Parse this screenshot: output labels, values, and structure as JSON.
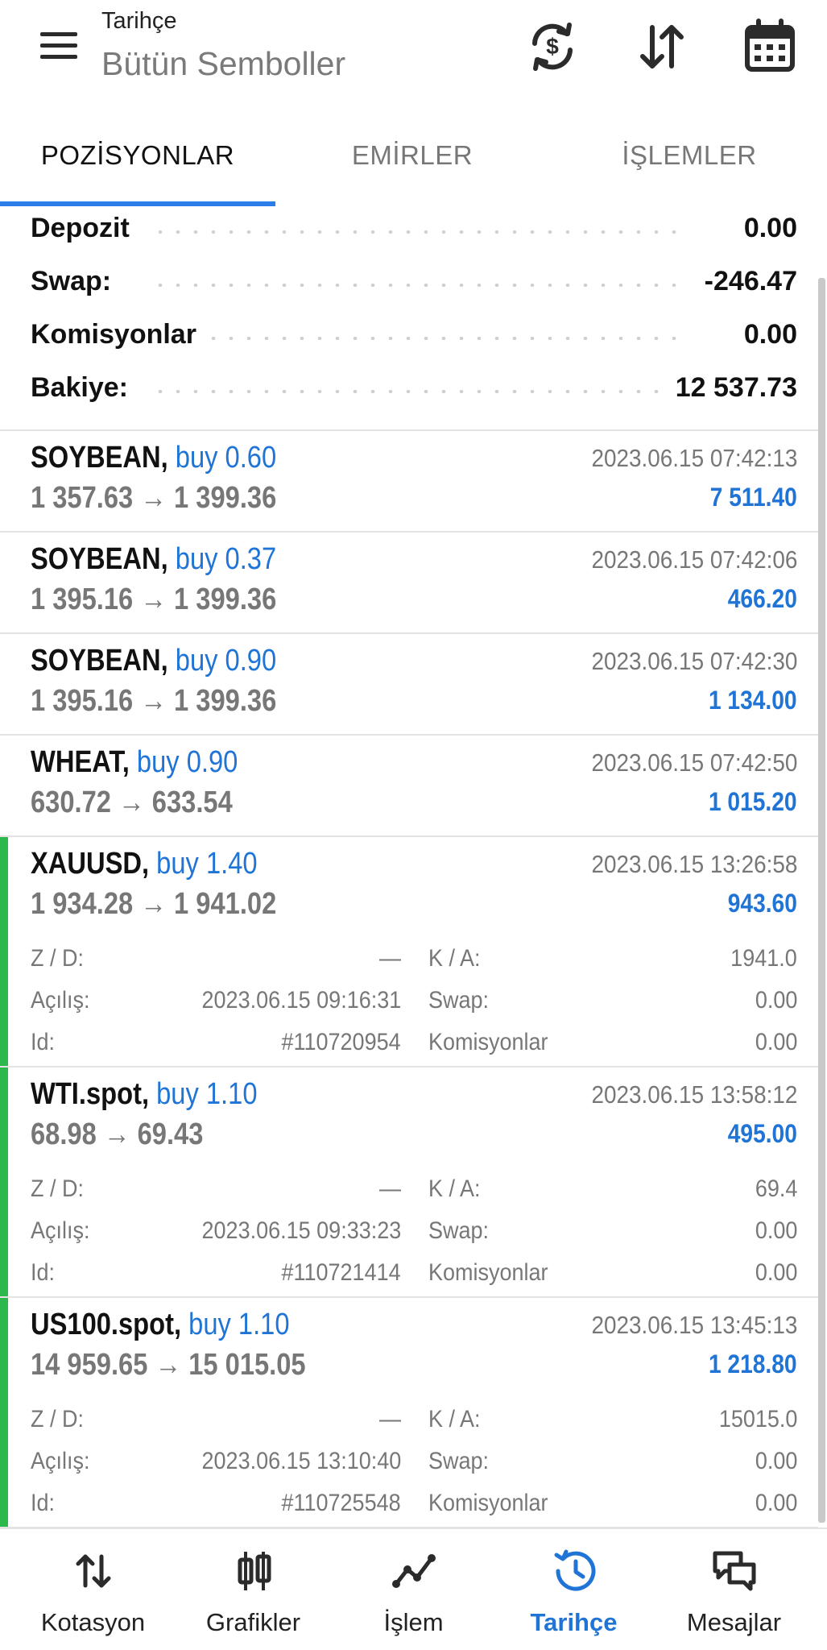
{
  "header": {
    "title": "Tarihçe",
    "subtitle": "Bütün Semboller",
    "icons": [
      "menu-icon",
      "currency-sync-icon",
      "sort-icon",
      "calendar-icon"
    ]
  },
  "tabs": [
    {
      "label": "POZİSYONLAR",
      "active": true
    },
    {
      "label": "EMİRLER",
      "active": false
    },
    {
      "label": "İŞLEMLER",
      "active": false
    }
  ],
  "summary": [
    {
      "label": "Depozit",
      "value": "0.00"
    },
    {
      "label": "Swap:",
      "value": "-246.47"
    },
    {
      "label": "Komisyonlar",
      "value": "0.00"
    },
    {
      "label": "Bakiye:",
      "value": "12 537.73"
    }
  ],
  "trades": [
    {
      "symbol": "SOYBEAN,",
      "side": "buy 0.60",
      "prices": "1 357.63 → 1 399.36",
      "time": "2023.06.15 07:42:13",
      "profit": "7 511.40"
    },
    {
      "symbol": "SOYBEAN,",
      "side": "buy 0.37",
      "prices": "1 395.16 → 1 399.36",
      "time": "2023.06.15 07:42:06",
      "profit": "466.20"
    },
    {
      "symbol": "SOYBEAN,",
      "side": "buy 0.90",
      "prices": "1 395.16 → 1 399.36",
      "time": "2023.06.15 07:42:30",
      "profit": "1 134.00"
    },
    {
      "symbol": "WHEAT,",
      "side": "buy 0.90",
      "prices": "630.72 → 633.54",
      "time": "2023.06.15 07:42:50",
      "profit": "1 015.20"
    },
    {
      "symbol": "XAUUSD,",
      "side": "buy 1.40",
      "prices": "1 934.28 → 1 941.02",
      "time": "2023.06.15 13:26:58",
      "profit": "943.60",
      "details": {
        "zd_label": "Z / D:",
        "zd": "—",
        "ka_label": "K / A:",
        "ka": "1941.0",
        "open_label": "Açılış:",
        "open": "2023.06.15 09:16:31",
        "swap_label": "Swap:",
        "swap": "0.00",
        "id_label": "Id:",
        "id": "#110720954",
        "comm_label": "Komisyonlar",
        "comm": "0.00"
      }
    },
    {
      "symbol": "WTI.spot,",
      "side": "buy 1.10",
      "prices": "68.98 → 69.43",
      "time": "2023.06.15 13:58:12",
      "profit": "495.00",
      "details": {
        "zd_label": "Z / D:",
        "zd": "—",
        "ka_label": "K / A:",
        "ka": "69.4",
        "open_label": "Açılış:",
        "open": "2023.06.15 09:33:23",
        "swap_label": "Swap:",
        "swap": "0.00",
        "id_label": "Id:",
        "id": "#110721414",
        "comm_label": "Komisyonlar",
        "comm": "0.00"
      }
    },
    {
      "symbol": "US100.spot,",
      "side": "buy 1.10",
      "prices": "14 959.65 → 15 015.05",
      "time": "2023.06.15 13:45:13",
      "profit": "1 218.80",
      "details": {
        "zd_label": "Z / D:",
        "zd": "—",
        "ka_label": "K / A:",
        "ka": "15015.0",
        "open_label": "Açılış:",
        "open": "2023.06.15 13:10:40",
        "swap_label": "Swap:",
        "swap": "0.00",
        "id_label": "Id:",
        "id": "#110725548",
        "comm_label": "Komisyonlar",
        "comm": "0.00"
      }
    }
  ],
  "nav": [
    {
      "label": "Kotasyon",
      "icon": "quotes-icon",
      "active": false
    },
    {
      "label": "Grafikler",
      "icon": "charts-icon",
      "active": false
    },
    {
      "label": "İşlem",
      "icon": "trade-icon",
      "active": false
    },
    {
      "label": "Tarihçe",
      "icon": "history-icon",
      "active": true
    },
    {
      "label": "Mesajlar",
      "icon": "messages-icon",
      "active": false
    }
  ],
  "colors": {
    "accent": "#2b7de9",
    "profit": "#1f74d6",
    "expanded_marker": "#2db84d"
  }
}
